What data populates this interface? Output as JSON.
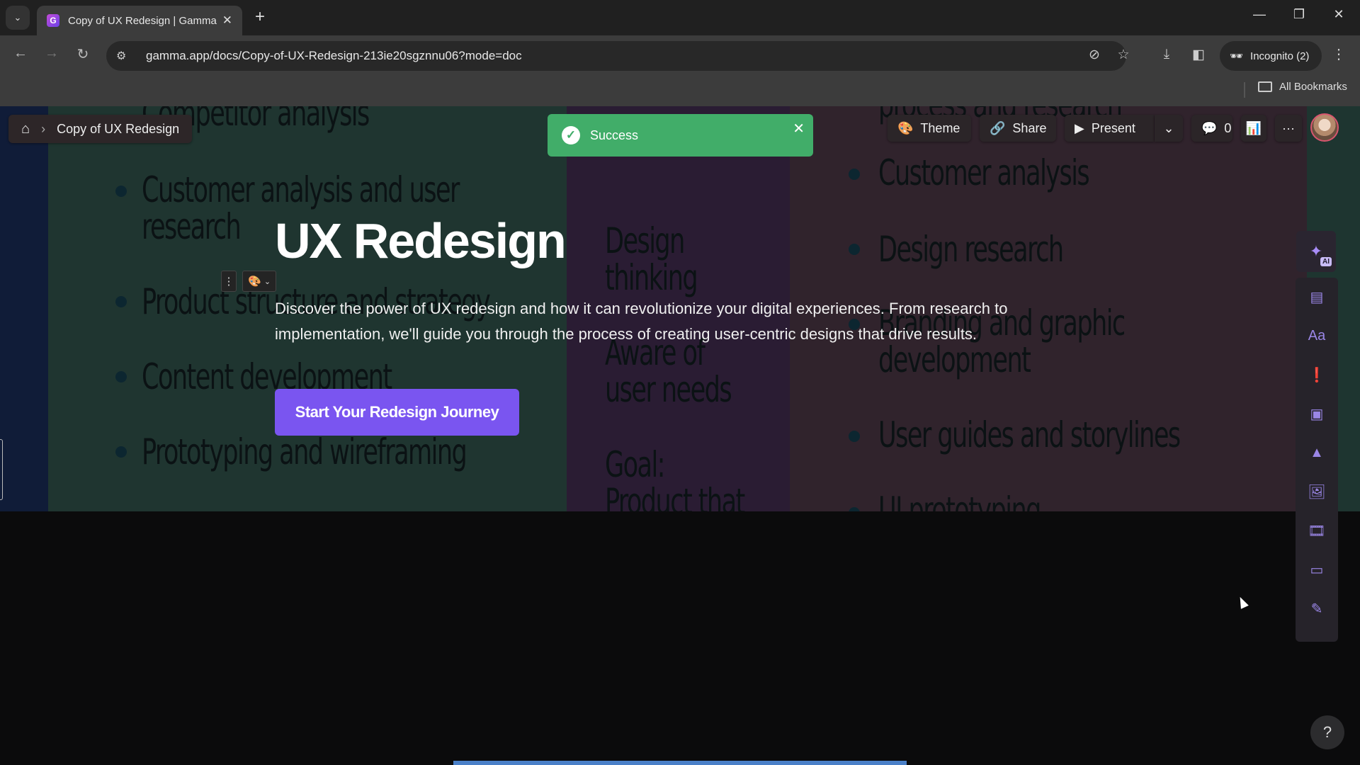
{
  "browser": {
    "tab_title": "Copy of UX Redesign | Gamma",
    "url": "gamma.app/docs/Copy-of-UX-Redesign-213ie20sgznnu06?mode=doc",
    "profile_label": "Incognito (2)",
    "bookmarks_label": "All Bookmarks"
  },
  "toolbar": {
    "breadcrumb_title": "Copy of UX Redesign",
    "theme_label": "Theme",
    "share_label": "Share",
    "present_label": "Present",
    "comments_count": "0"
  },
  "toast": {
    "message": "Success",
    "color": "#41ad69"
  },
  "hero": {
    "title": "UX Redesign",
    "description": "Discover the power of UX redesign and how it can revolutionize your digital experiences. From research to implementation, we'll guide you through the process of creating user-centric designs that drive results.",
    "cta_label": "Start Your Redesign Journey",
    "cta_color": "#7a55f0"
  },
  "background": {
    "left_items": [
      "Competitor analysis",
      "Customer analysis and user",
      "research",
      "Product structure and strategy",
      "Content development",
      "Prototyping and wireframing"
    ],
    "middle_items": [
      "Design",
      "thinking",
      "Aware of",
      "user needs",
      "Goal:",
      "Product that"
    ],
    "right_items": [
      "process and research",
      "Customer analysis",
      "Design research",
      "Branding and graphic",
      "development",
      "User guides and storylines",
      "UI prototyping"
    ]
  },
  "side_tools": {
    "ai_badge": "AI",
    "items": [
      "add-card",
      "text-styles",
      "callout",
      "layout",
      "shapes",
      "image",
      "video",
      "embed",
      "form"
    ]
  },
  "help_label": "?"
}
